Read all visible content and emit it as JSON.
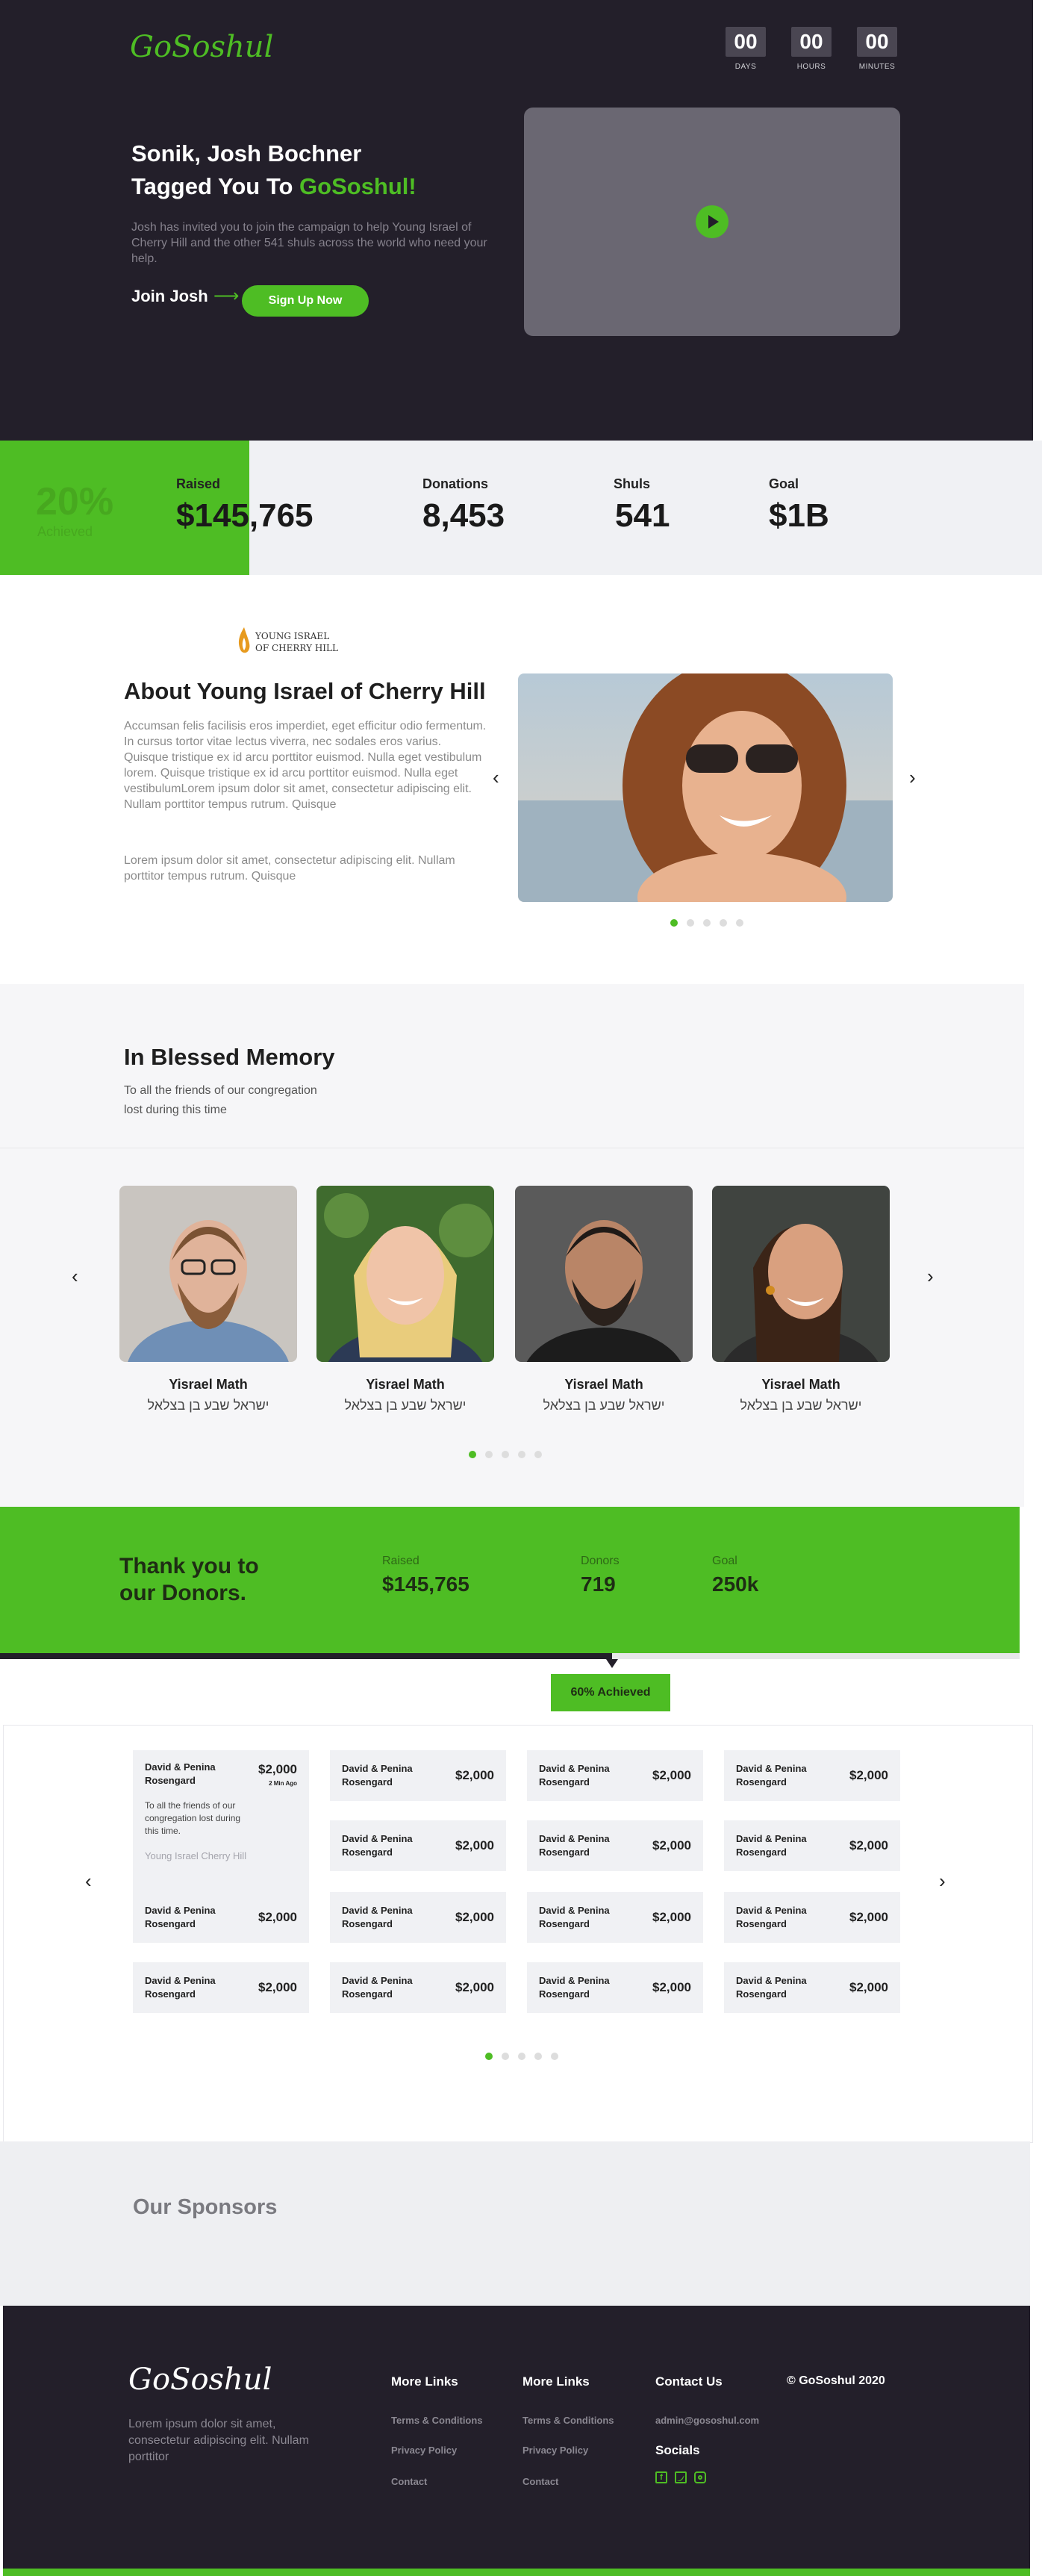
{
  "header": {
    "logo": "GoSoshul",
    "countdown": [
      {
        "value": "00",
        "label": "DAYS"
      },
      {
        "value": "00",
        "label": "HOURS"
      },
      {
        "value": "00",
        "label": "MINUTES"
      }
    ]
  },
  "hero": {
    "line1": "Sonik, Josh Bochner",
    "line2_prefix": "Tagged You To ",
    "line2_brand": "GoSoshul!",
    "description": "Josh has invited you to join the campaign to help Young Israel of Cherry Hill and the other 541 shuls across the world who need your help.",
    "join_label": "Join Josh",
    "arrow": "⟶",
    "signup_button": "Sign Up Now"
  },
  "stats": {
    "achieved_value": "20%",
    "achieved_label": "Achieved",
    "items": [
      {
        "label": "Raised",
        "value": "$145,765"
      },
      {
        "label": "Donations",
        "value": "8,453"
      },
      {
        "label": "Shuls",
        "value": "541"
      },
      {
        "label": "Goal",
        "value": "$1B"
      }
    ]
  },
  "about": {
    "org_logo_line1": "YOUNG ISRAEL",
    "org_logo_line2": "OF CHERRY HILL",
    "title": "About Young Israel of Cherry Hill",
    "p1": "Accumsan felis facilisis eros imperdiet, eget efficitur odio fermentum. In cursus tortor vitae lectus viverra, nec sodales eros varius. Quisque tristique ex id arcu porttitor euismod. Nulla eget vestibulum lorem. Quisque tristique ex id arcu porttitor euismod. Nulla eget vestibulumLorem ipsum dolor sit amet, consectetur adipiscing elit. Nullam porttitor tempus rutrum. Quisque",
    "p2": "Lorem ipsum dolor sit amet, consectetur adipiscing elit. Nullam porttitor tempus rutrum. Quisque",
    "prev": "‹",
    "next": "›"
  },
  "memory": {
    "title": "In Blessed Memory",
    "subtitle_line1": "To all the friends of our congregation",
    "subtitle_line2": "lost during this time",
    "people": [
      {
        "name": "Yisrael Math",
        "hebrew": "ישראל שבע בן בצלאל"
      },
      {
        "name": "Yisrael Math",
        "hebrew": "ישראל שבע בן בצלאל"
      },
      {
        "name": "Yisrael Math",
        "hebrew": "ישראל שבע בן בצלאל"
      },
      {
        "name": "Yisrael Math",
        "hebrew": "ישראל שבע בן בצלאל"
      }
    ],
    "prev": "‹",
    "next": "›"
  },
  "donors_banner": {
    "title_line1": "Thank you to",
    "title_line2": "our Donors.",
    "stats": [
      {
        "label": "Raised",
        "value": "$145,765"
      },
      {
        "label": "Donors",
        "value": "719"
      },
      {
        "label": "Goal",
        "value": "250k"
      }
    ],
    "progress_fraction": 0.6,
    "progress_label": "60% Achieved"
  },
  "donors": {
    "featured": {
      "name_line1": "David & Penina",
      "name_line2": "Rosengard",
      "amount": "$2,000",
      "time": "2 Min Ago",
      "message": "To all the friends of our congregation lost during this time.",
      "org": "Young Israel Cherry Hill"
    },
    "card_name_line1": "David & Penina",
    "card_name_line2": "Rosengard",
    "card_amount": "$2,000",
    "prev": "‹",
    "next": "›"
  },
  "sponsors": {
    "title": "Our Sponsors"
  },
  "footer": {
    "logo": "GoSoshul",
    "tagline": "Lorem ipsum dolor sit amet, consectetur adipiscing elit. Nullam porttitor",
    "col1": {
      "title": "More Links",
      "links": [
        "Terms & Conditions",
        "Privacy Policy",
        "Contact"
      ]
    },
    "col2": {
      "title": "More Links",
      "links": [
        "Terms & Conditions",
        "Privacy Policy",
        "Contact"
      ]
    },
    "contact": {
      "title": "Contact Us",
      "email": "admin@gososhul.com",
      "socials_title": "Socials"
    },
    "copyright": "© GoSoshul 2020"
  },
  "colors": {
    "brand_green": "#4ebd24",
    "dark": "#231f2a"
  }
}
